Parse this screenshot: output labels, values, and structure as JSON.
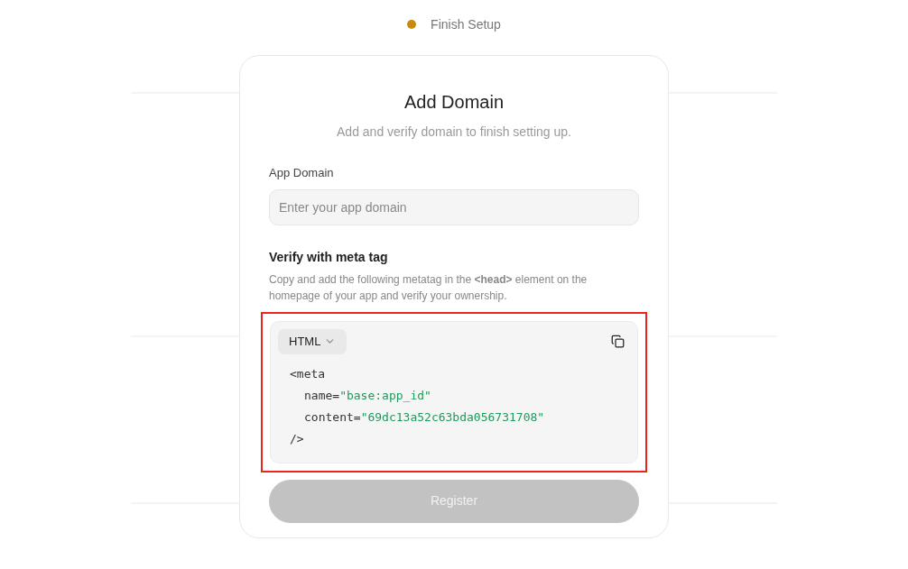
{
  "status": {
    "label": "Finish Setup",
    "color": "#c98a0a"
  },
  "dialog": {
    "title": "Add Domain",
    "subtitle": "Add and verify domain to finish setting up.",
    "field": {
      "label": "App Domain",
      "placeholder": "Enter your app domain"
    },
    "verify": {
      "title": "Verify with meta tag",
      "description": "Copy and add the following metatag in the **<head>** element on the homepage of your app and verify your ownership."
    },
    "code": {
      "highlighted": true,
      "language": "HTML",
      "lines": [
        {
          "indented": false,
          "tokens": [
            {
              "kind": "plain",
              "text": "<meta"
            }
          ]
        },
        {
          "indented": true,
          "tokens": [
            {
              "kind": "plain",
              "text": "name="
            },
            {
              "kind": "string",
              "text": "\"base:app_id\""
            }
          ]
        },
        {
          "indented": true,
          "tokens": [
            {
              "kind": "plain",
              "text": "content="
            },
            {
              "kind": "string",
              "text": "\"69dc13a52c63bda056731708\""
            }
          ]
        },
        {
          "indented": false,
          "tokens": [
            {
              "kind": "plain",
              "text": "/>"
            }
          ]
        }
      ]
    },
    "submit": {
      "label": "Register",
      "disabled": true
    }
  }
}
